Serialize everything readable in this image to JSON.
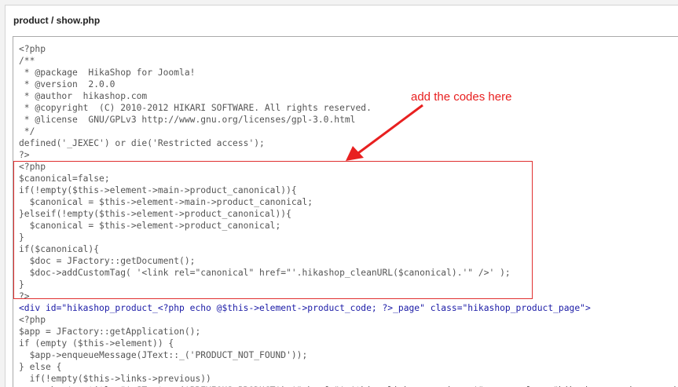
{
  "file_path": "product / show.php",
  "code_lines": [
    "<?php",
    "/**",
    " * @package  HikaShop for Joomla!",
    " * @version  2.0.0",
    " * @author  hikashop.com",
    " * @copyright  (C) 2010-2012 HIKARI SOFTWARE. All rights reserved.",
    " * @license  GNU/GPLv3 http://www.gnu.org/licenses/gpl-3.0.html",
    " */",
    "defined('_JEXEC') or die('Restricted access');",
    "?>",
    "<?php",
    "$canonical=false;",
    "if(!empty($this->element->main->product_canonical)){",
    "  $canonical = $this->element->main->product_canonical;",
    "}elseif(!empty($this->element->product_canonical)){",
    "  $canonical = $this->element->product_canonical;",
    "}",
    "if($canonical){",
    "  $doc = JFactory::getDocument();",
    "  $doc->addCustomTag( '<link rel=\"canonical\" href=\"'.hikashop_cleanURL($canonical).'\" />' );",
    "}",
    "?>",
    "<div id=\"hikashop_product_<?php echo @$this->element->product_code; ?>_page\" class=\"hikashop_product_page\">",
    "<?php",
    "$app = JFactory::getApplication();",
    "if (empty ($this->element)) {",
    "  $app->enqueueMessage(JText::_('PRODUCT_NOT_FOUND'));",
    "} else {",
    "  if(!empty($this->links->previous))",
    "    echo '<a title=\"'.JText::_('PREVIOUS_PRODUCT').'\" href=\"'.$this->links->previous.'\"><span class=\"hikashop_previous_product\"></span></a>';"
  ],
  "annotation": {
    "text": "add the codes here",
    "color": "#e82020"
  },
  "colors": {
    "code_text": "#555555",
    "html_tag": "#1a1aa6",
    "highlight_border": "#e03030"
  }
}
